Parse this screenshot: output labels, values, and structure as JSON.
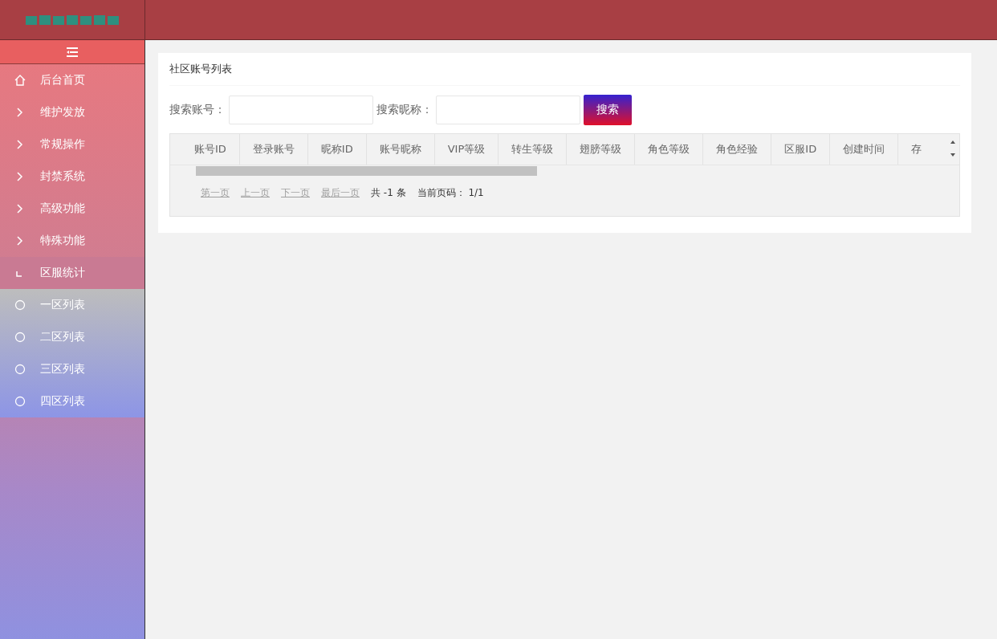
{
  "sidebar": {
    "items": [
      {
        "kind": "home",
        "label": "后台首页",
        "expanded": false
      },
      {
        "kind": "group",
        "label": "维护发放",
        "expanded": false
      },
      {
        "kind": "group",
        "label": "常规操作",
        "expanded": false
      },
      {
        "kind": "group",
        "label": "封禁系统",
        "expanded": false
      },
      {
        "kind": "group",
        "label": "高级功能",
        "expanded": false
      },
      {
        "kind": "group",
        "label": "特殊功能",
        "expanded": false
      },
      {
        "kind": "group",
        "label": "区服统计",
        "expanded": true,
        "children": [
          {
            "label": "一区列表"
          },
          {
            "label": "二区列表"
          },
          {
            "label": "三区列表"
          },
          {
            "label": "四区列表"
          }
        ]
      }
    ]
  },
  "panel": {
    "title": "社区账号列表",
    "search": [
      {
        "label": "搜索账号："
      },
      {
        "label": "搜索昵称："
      }
    ],
    "search_button": "搜索",
    "table": {
      "columns": [
        "账号ID",
        "登录账号",
        "昵称ID",
        "账号昵称",
        "VIP等级",
        "转生等级",
        "翅膀等级",
        "角色等级",
        "角色经验",
        "区服ID",
        "创建时间",
        "存"
      ]
    },
    "pager": {
      "links": [
        {
          "label": "第一页",
          "disabled": true
        },
        {
          "label": "上一页",
          "disabled": true
        },
        {
          "label": "下一页",
          "disabled": true
        },
        {
          "label": "最后一页",
          "disabled": true
        }
      ],
      "total": "共 -1 条",
      "page": "当前页码： 1/1"
    }
  }
}
